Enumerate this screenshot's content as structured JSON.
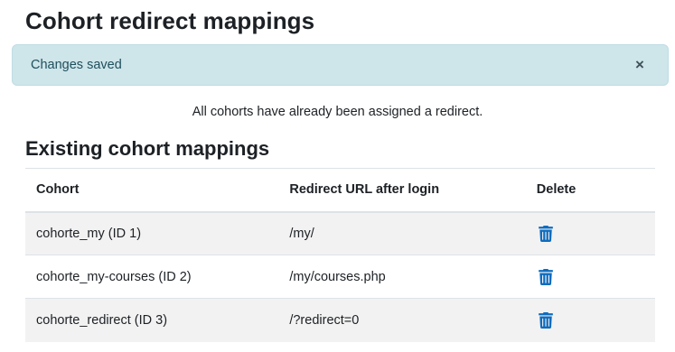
{
  "page": {
    "title": "Cohort redirect mappings"
  },
  "alert": {
    "message": "Changes saved",
    "close_label": "×"
  },
  "info_message": "All cohorts have already been assigned a redirect.",
  "section_title": "Existing cohort mappings",
  "table": {
    "headers": {
      "cohort": "Cohort",
      "url": "Redirect URL after login",
      "delete": "Delete"
    },
    "rows": [
      {
        "cohort": "cohorte_my (ID 1)",
        "url": "/my/",
        "delete_icon": "trash-icon"
      },
      {
        "cohort": "cohorte_my-courses (ID 2)",
        "url": "/my/courses.php",
        "delete_icon": "trash-icon"
      },
      {
        "cohort": "cohorte_redirect (ID 3)",
        "url": "/?redirect=0",
        "delete_icon": "trash-icon"
      }
    ]
  },
  "colors": {
    "alert_background": "#cee5ea",
    "alert_text": "#1f4f5c",
    "delete_icon": "#0f6cbf",
    "striped_row": "#f2f2f2"
  }
}
